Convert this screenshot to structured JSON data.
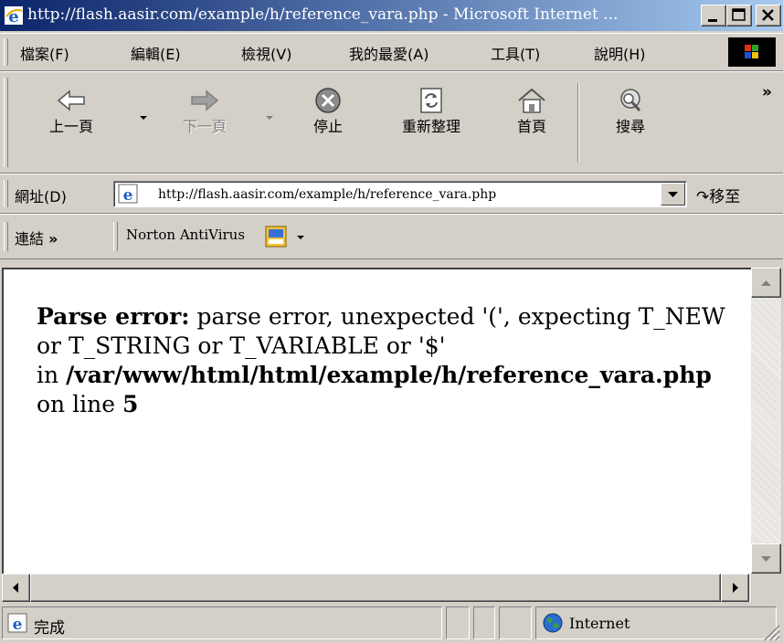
{
  "window": {
    "title": "http://flash.aasir.com/example/h/reference_vara.php - Microsoft Internet ..."
  },
  "menu": {
    "items": [
      {
        "label": "檔案(F)"
      },
      {
        "label": "編輯(E)"
      },
      {
        "label": "檢視(V)"
      },
      {
        "label": "我的最愛(A)"
      },
      {
        "label": "工具(T)"
      },
      {
        "label": "說明(H)"
      }
    ]
  },
  "toolbar": {
    "back_label": "上一頁",
    "forward_label": "下一頁",
    "stop_label": "停止",
    "refresh_label": "重新整理",
    "home_label": "首頁",
    "search_label": "搜尋",
    "chevron": "»"
  },
  "address": {
    "label": "網址(D)",
    "url": "http://flash.aasir.com/example/h/reference_vara.php",
    "go_label": "移至"
  },
  "links": {
    "label": "連結",
    "chevron": "»",
    "norton_label": "Norton AntiVirus"
  },
  "content": {
    "error_label": "Parse error:",
    "error_message": "parse error, unexpected '(', expecting T_NEW or T_STRING or T_VARIABLE or '$'",
    "in_label": "in",
    "file_path": "/var/www/html/html/example/h/reference_vara.php",
    "on_line_label": "on line",
    "line_number": "5"
  },
  "status": {
    "text": "完成",
    "zone": "Internet"
  },
  "colors": {
    "title_start": "#0a246a",
    "title_end": "#a6caf0",
    "chrome": "#d4d0c8"
  }
}
